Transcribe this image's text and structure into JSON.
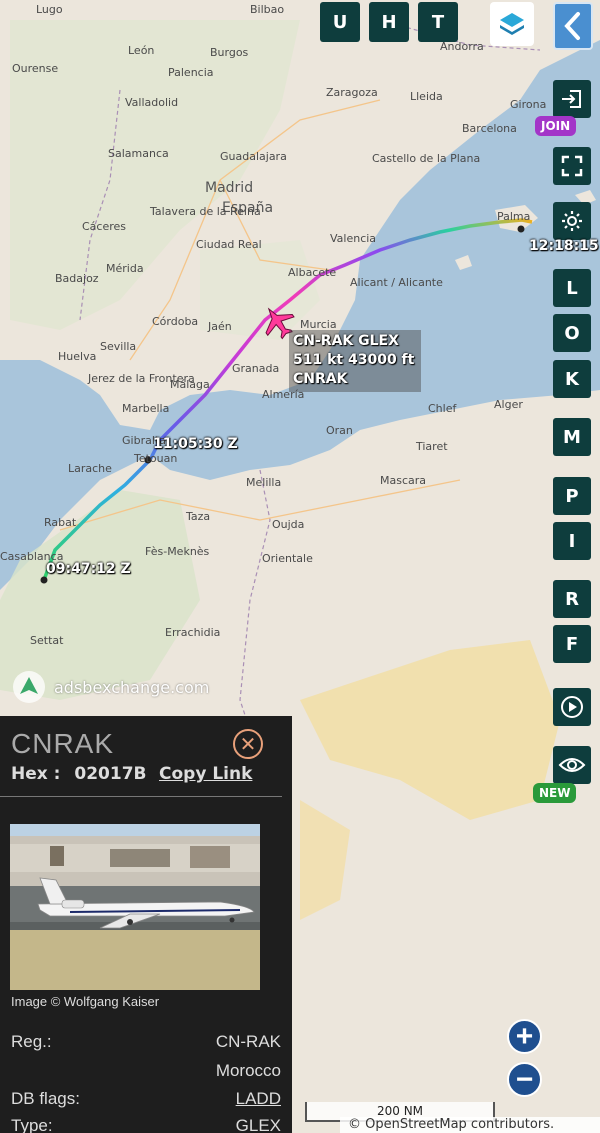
{
  "top_buttons": [
    {
      "label": "U"
    },
    {
      "label": "H"
    },
    {
      "label": "T"
    }
  ],
  "side_buttons": {
    "join_badge": "JOIN",
    "letters": [
      "L",
      "O",
      "K",
      "M",
      "P",
      "I",
      "R",
      "F"
    ],
    "new_badge": "NEW"
  },
  "map_labels": [
    "Lugo",
    "Bilbao",
    "León",
    "Burgos",
    "Ourense",
    "Palencia",
    "Valladolid",
    "Zaragoza",
    "Lleida",
    "Girona",
    "Andorra",
    "Barcelona",
    "Salamanca",
    "Guadalajara",
    "Madrid",
    "España",
    "Castello de la Plana",
    "Talavera de la Reina",
    "Cáceres",
    "Ciudad Real",
    "Albacete",
    "Valencia",
    "Mérida",
    "Badajoz",
    "Alicant / Alicante",
    "Córdoba",
    "Jaén",
    "Sevilla",
    "Huelva",
    "Murcia",
    "Granada",
    "Málaga",
    "Almería",
    "Marbella",
    "Jerez de la Frontera",
    "Gibraltar",
    "Tetouan",
    "Larache",
    "Rabat",
    "Casablanca",
    "Settat",
    "Taza",
    "Oujda",
    "Melilla",
    "Oran",
    "Chlef",
    "Alger",
    "Tiaret",
    "Mascara",
    "Errachidia",
    "Palma",
    "Fès-Meknès",
    "Orientale"
  ],
  "track": {
    "time_start": "09:47:12 Z",
    "time_mid": "11:05:30 Z",
    "time_end": "12:18:15"
  },
  "aircraft_label": {
    "line1": "CN-RAK GLEX",
    "line2": "511 kt  43000 ft",
    "line3": "CNRAK"
  },
  "watermark": "adsbexchange.com",
  "panel": {
    "callsign": "CNRAK",
    "hex_label": "Hex :",
    "hex_value": "02017B",
    "copy_link": "Copy Link",
    "image_credit": "Image © Wolfgang Kaiser",
    "rows": [
      {
        "key": "Reg.:",
        "value": "CN-RAK"
      },
      {
        "key": "",
        "value": "Morocco"
      },
      {
        "key": "DB flags:",
        "value": "LADD"
      },
      {
        "key": "Type:",
        "value": "GLEX"
      }
    ]
  },
  "scale_label": "200 NM",
  "attribution": "© OpenStreetMap contributors.",
  "colors": {
    "button_bg": "#0e3d3d",
    "join_badge": "#a335c8",
    "new_badge": "#2a9a3a",
    "back_button": "#4a8fd0",
    "panel_bg": "#1e1e1e",
    "aircraft": "#ff3a9a"
  }
}
